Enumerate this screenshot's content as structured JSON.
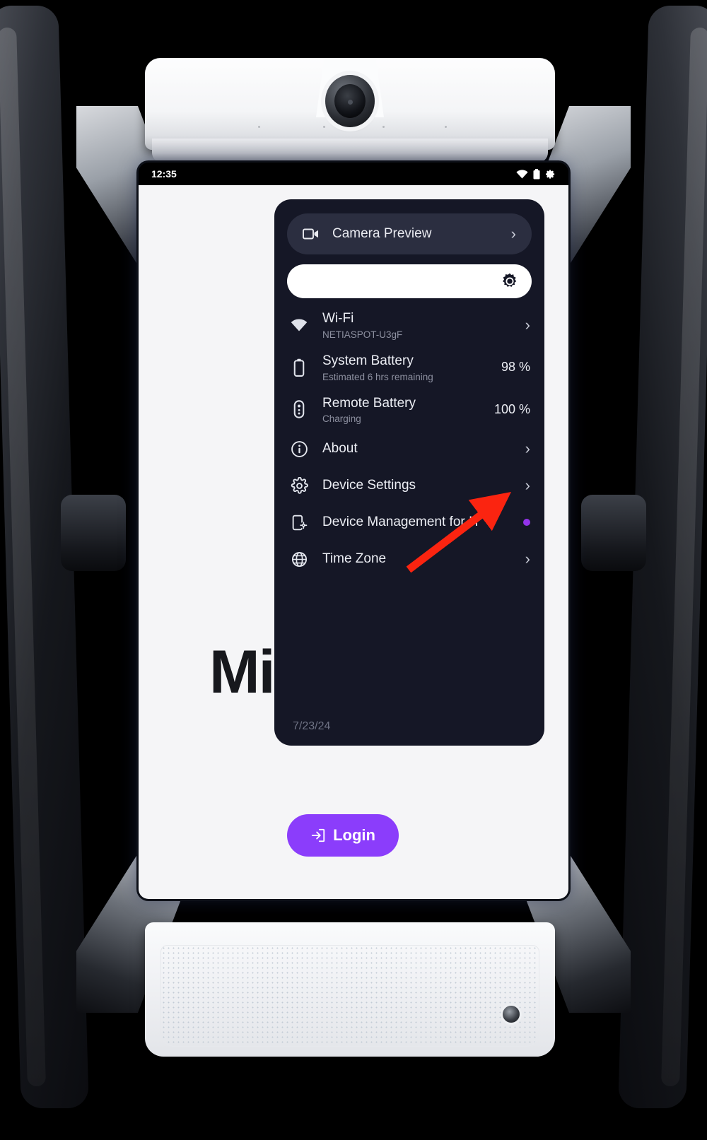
{
  "device": {
    "name": "video-conferencing-robot",
    "camera_icon": "camera-lens",
    "speaker_icon": "speaker-grille"
  },
  "status_bar": {
    "time": "12:35",
    "icons": [
      "wifi-icon",
      "battery-icon",
      "gear-icon"
    ]
  },
  "home_screen": {
    "brand_text": "Mi",
    "login_button": "Login",
    "login_icon": "login-arrow-icon",
    "background_blobs": [
      "#f472f7",
      "#8c3cf0"
    ],
    "background_color": "#f5f5f7"
  },
  "settings_panel": {
    "camera_preview": {
      "label": "Camera Preview",
      "icon": "video-camera-icon",
      "chevron": "›"
    },
    "brightness": {
      "icon": "brightness-sun-icon",
      "value_percent": 100
    },
    "items": [
      {
        "id": "wifi",
        "icon": "wifi-icon",
        "title": "Wi-Fi",
        "subtitle": "NETIASPOT-U3gF",
        "value": "",
        "accessory": "chevron"
      },
      {
        "id": "system-battery",
        "icon": "battery-icon",
        "title": "System Battery",
        "subtitle": "Estimated 6 hrs remaining",
        "value": "98 %",
        "accessory": "value"
      },
      {
        "id": "remote-battery",
        "icon": "remote-icon",
        "title": "Remote Battery",
        "subtitle": "Charging",
        "value": "100 %",
        "accessory": "value"
      },
      {
        "id": "about",
        "icon": "info-icon",
        "title": "About",
        "subtitle": "",
        "value": "",
        "accessory": "chevron"
      },
      {
        "id": "device-settings",
        "icon": "gear-icon",
        "title": "Device Settings",
        "subtitle": "",
        "value": "",
        "accessory": "chevron"
      },
      {
        "id": "device-management-for-it",
        "icon": "device-management-icon",
        "title": "Device Management for IT",
        "subtitle": "",
        "value": "",
        "accessory": "dot"
      },
      {
        "id": "time-zone",
        "icon": "globe-icon",
        "title": "Time Zone",
        "subtitle": "",
        "value": "",
        "accessory": "chevron"
      }
    ],
    "date": "7/23/24",
    "panel_bg": "#151726",
    "accent_color": "#9333ea"
  },
  "annotation": {
    "type": "arrow",
    "color": "#fb2410",
    "points_to": "about-chevron"
  }
}
